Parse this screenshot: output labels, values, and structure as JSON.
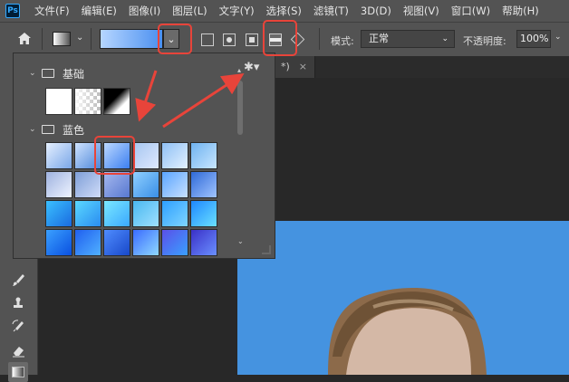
{
  "app": {
    "logo": "Ps"
  },
  "menu": [
    "文件(F)",
    "编辑(E)",
    "图像(I)",
    "图层(L)",
    "文字(Y)",
    "选择(S)",
    "滤镜(T)",
    "3D(D)",
    "视图(V)",
    "窗口(W)",
    "帮助(H)"
  ],
  "options_bar": {
    "gradient_colors": [
      "#b6d6ff",
      "#4a8ff0"
    ],
    "mode_label": "模式:",
    "mode_value": "正常",
    "opacity_label": "不透明度:",
    "opacity_value": "100%"
  },
  "document_tab": {
    "title": "*)",
    "close": "×"
  },
  "gradient_panel": {
    "groups": [
      {
        "name": "基础",
        "expanded": true
      },
      {
        "name": "蓝色",
        "expanded": true
      }
    ]
  },
  "colors": {
    "accent_red": "#e8443a",
    "photo_bg": "#4593e0"
  },
  "icons": [
    "home-icon",
    "gear-icon",
    "folder-icon",
    "brush-icon",
    "stamp-icon",
    "history-brush-icon",
    "eraser-icon",
    "gradient-icon"
  ]
}
